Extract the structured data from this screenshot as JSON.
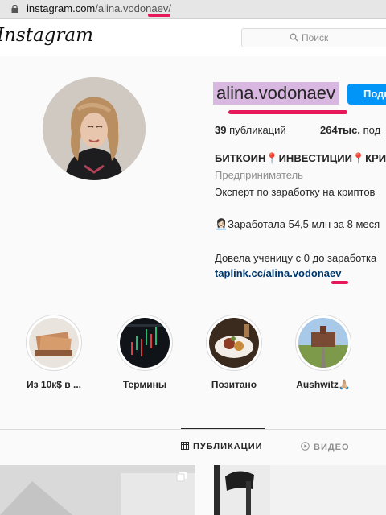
{
  "browser": {
    "url_host": "instagram.com",
    "url_path": "/alina.vodonaev/"
  },
  "header": {
    "logo": "Instagram",
    "search_placeholder": "Поиск"
  },
  "profile": {
    "username": "alina.vodonaev",
    "follow_label": "Подп",
    "posts_count": "39",
    "posts_label": "публикаций",
    "followers_count": "264тыс.",
    "followers_label": "под",
    "bio_name": "БИТКОИН📍ИНВЕСТИЦИИ📍КРИ",
    "category": "Предприниматель",
    "bio_line1": "Эксперт по заработку на криптов",
    "bio_line2": "👩🏻‍💼Заработала 54,5 млн за 8 меся",
    "bio_line3": "Довела ученицу с 0 до заработка",
    "link": "taplink.cc/alina.vodonaev"
  },
  "highlights": [
    {
      "label": "Из 10к$ в ...",
      "icon": "money-highlight"
    },
    {
      "label": "Термины",
      "icon": "chart-highlight"
    },
    {
      "label": "Позитано",
      "icon": "food-highlight"
    },
    {
      "label": "Aushwitz🙏🏼",
      "icon": "railway-highlight"
    }
  ],
  "tabs": {
    "publications": "ПУБЛИКАЦИИ",
    "video": "ВИДЕО"
  },
  "colors": {
    "highlight_username": "#d8b8e0",
    "annotation_pink": "#e8195a",
    "follow_blue": "#0095f6",
    "link": "#00376b"
  }
}
